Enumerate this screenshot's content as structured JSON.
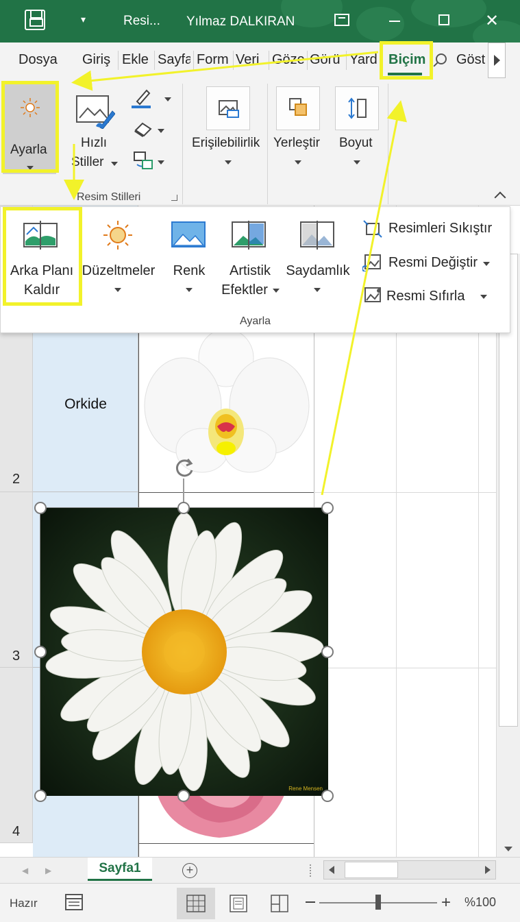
{
  "titlebar": {
    "doc_title": "Resi...",
    "user_name": "Yılmaz DALKIRAN",
    "qat_dropdown": "▾",
    "close_glyph": "✕"
  },
  "tabs": [
    {
      "label": "Dosya"
    },
    {
      "label": "Giriş"
    },
    {
      "label": "Ekle"
    },
    {
      "label": "Sayfa"
    },
    {
      "label": "Form"
    },
    {
      "label": "Veri"
    },
    {
      "label": "Göze"
    },
    {
      "label": "Görü"
    },
    {
      "label": "Yard"
    },
    {
      "label": "Biçim"
    },
    {
      "label": "Göst"
    }
  ],
  "ribbon": {
    "ayarla": "Ayarla",
    "hizli_stiller_1": "Hızlı",
    "hizli_stiller_2": "Stiller",
    "resim_stilleri": "Resim Stilleri",
    "erisilebilirlik": "Erişilebilirlik",
    "yerlestir": "Yerleştir",
    "boyut": "Boyut"
  },
  "gallery": {
    "arka_plani_1": "Arka Planı",
    "arka_plani_2": "Kaldır",
    "duzeltmeler": "Düzeltmeler",
    "renk": "Renk",
    "artistik_1": "Artistik",
    "artistik_2": "Efektler",
    "saydamlik": "Saydamlık",
    "resimleri_sikistir": "Resimleri Sıkıştır",
    "resmi_degistir": "Resmi Değiştir",
    "resmi_sifirla": "Resmi Sıfırla",
    "group_label": "Ayarla"
  },
  "sheet": {
    "rows": [
      {
        "number": "2",
        "label": "Orkide"
      },
      {
        "number": "3",
        "label": ""
      },
      {
        "number": "4",
        "label": ""
      }
    ],
    "photo_credit": "Rene Mensen"
  },
  "sheet_tabs": {
    "active": "Sayfa1",
    "add": "+"
  },
  "status": {
    "ready": "Hazır",
    "zoom": "%100"
  },
  "colors": {
    "excel_green": "#217346",
    "highlight_yellow": "#f2f22a",
    "column_a_fill": "#ddebf7"
  }
}
